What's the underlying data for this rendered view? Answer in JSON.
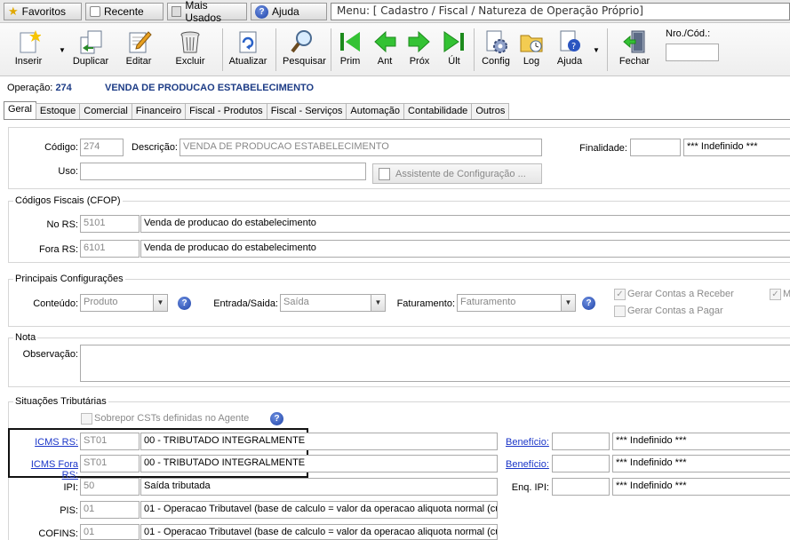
{
  "topbar": {
    "favoritos": "Favoritos",
    "recente": "Recente",
    "mais_usados": "Mais Usados",
    "ajuda": "Ajuda",
    "menu_title": "Menu: [ Cadastro / Fiscal / Natureza de Operação Próprio]"
  },
  "toolbar": {
    "inserir": "Inserir",
    "duplicar": "Duplicar",
    "editar": "Editar",
    "excluir": "Excluir",
    "atualizar": "Atualizar",
    "pesquisar": "Pesquisar",
    "prim": "Prim",
    "ant": "Ant",
    "prox": "Próx",
    "ult": "Últ",
    "config": "Config",
    "log": "Log",
    "ajuda": "Ajuda",
    "fechar": "Fechar",
    "nro_label": "Nro./Cód.:",
    "nro_value": ""
  },
  "header": {
    "operacao_label": "Operação:",
    "operacao_code": "274",
    "operacao_desc": "VENDA DE PRODUCAO ESTABELECIMENTO"
  },
  "tabs": [
    "Geral",
    "Estoque",
    "Comercial",
    "Financeiro",
    "Fiscal - Produtos",
    "Fiscal - Serviços",
    "Automação",
    "Contabilidade",
    "Outros"
  ],
  "geral": {
    "codigo_label": "Código:",
    "codigo_value": "274",
    "descricao_label": "Descrição:",
    "descricao_value": "VENDA DE PRODUCAO ESTABELECIMENTO",
    "finalidade_label": "Finalidade:",
    "finalidade_code": "",
    "finalidade_value": "*** Indefinido ***",
    "uso_label": "Uso:",
    "uso_value": "",
    "assistente_label": "Assistente de Configuração ..."
  },
  "cfop": {
    "title": "Códigos Fiscais (CFOP)",
    "no_rs_label": "No RS:",
    "no_rs_code": "5101",
    "no_rs_desc": "Venda de producao do estabelecimento",
    "fora_rs_label": "Fora RS:",
    "fora_rs_code": "6101",
    "fora_rs_desc": "Venda de producao do estabelecimento"
  },
  "config": {
    "title": "Principais Configurações",
    "conteudo_label": "Conteúdo:",
    "conteudo_value": "Produto",
    "entrada_label": "Entrada/Saida:",
    "entrada_value": "Saída",
    "faturamento_label": "Faturamento:",
    "faturamento_value": "Faturamento",
    "gerar_receber": "Gerar Contas a Receber",
    "gerar_pagar": "Gerar Contas a Pagar",
    "m_label": "M"
  },
  "nota": {
    "title": "Nota",
    "observacao_label": "Observação:",
    "observacao_value": ""
  },
  "situacoes": {
    "title": "Situações Tributárias",
    "sobrepor": "Sobrepor CSTs definidas no Agente",
    "icms_rs_label": "ICMS RS:",
    "icms_rs_code": "ST01",
    "icms_rs_desc": "00 - TRIBUTADO INTEGRALMENTE",
    "icms_fora_label": "ICMS Fora RS:",
    "icms_fora_code": "ST01",
    "icms_fora_desc": "00 - TRIBUTADO INTEGRALMENTE",
    "beneficio_label": "Benefício:",
    "beneficio_value": "*** Indefinido ***",
    "beneficio2_value": "*** Indefinido ***",
    "ipi_label": "IPI:",
    "ipi_code": "50",
    "ipi_desc": "Saída tributada",
    "enq_ipi_label": "Enq. IPI:",
    "enq_ipi_value": "*** Indefinido ***",
    "pis_label": "PIS:",
    "pis_code": "01",
    "pis_desc": "01 - Operacao Tributavel (base de calculo = valor da operacao aliquota normal (cu",
    "cofins_label": "COFINS:",
    "cofins_code": "01",
    "cofins_desc": "01 - Operacao Tributavel (base de calculo = valor da operacao aliquota normal (cu"
  }
}
